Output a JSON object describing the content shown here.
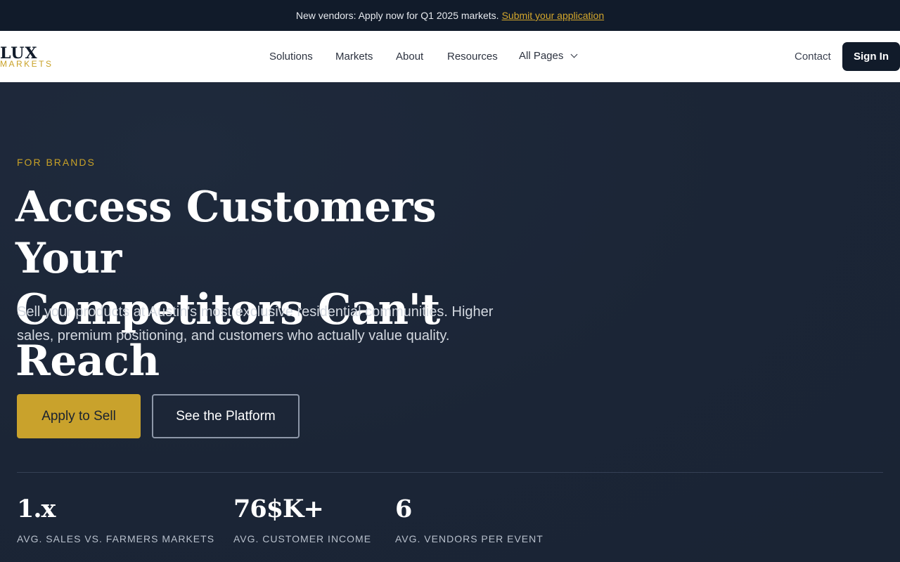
{
  "announcement": {
    "text": "New vendors: Apply now for Q1 2025 markets.",
    "link": "Submit your application"
  },
  "logo": {
    "primary": "LUX",
    "secondary": "MARKETS"
  },
  "nav": {
    "items": [
      "Solutions",
      "Markets",
      "About",
      "Resources"
    ],
    "all_pages": "All Pages",
    "contact": "Contact",
    "sign_in": "Sign In"
  },
  "hero": {
    "eyebrow": "FOR BRANDS",
    "headline_line1": "Access Customers Your",
    "headline_line2": "Competitors Can't Reach",
    "subtext": "Sell your products at Austin's most exclusive residential communities. Higher sales, premium positioning, and customers who actually value quality.",
    "primary_cta": "Apply to Sell",
    "secondary_cta": "See the Platform"
  },
  "stats": [
    {
      "value": "1.x",
      "label": "AVG. SALES VS. FARMERS MARKETS"
    },
    {
      "value": "76$K+",
      "label": "AVG. CUSTOMER INCOME"
    },
    {
      "value": "6",
      "label": "AVG. VENDORS PER EVENT"
    }
  ],
  "colors": {
    "accent_gold": "#c9a22c",
    "navy_dark": "#111b2a",
    "hero_bg": "#1c2637"
  }
}
